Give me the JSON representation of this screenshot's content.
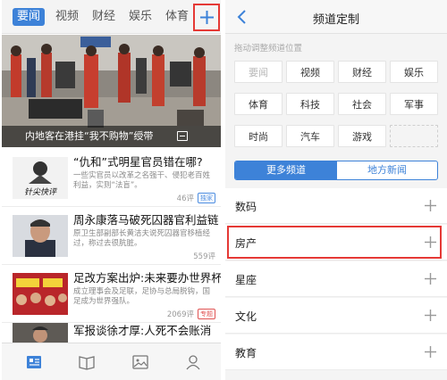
{
  "left": {
    "tabs": [
      {
        "label": "要闻",
        "active": true
      },
      {
        "label": "视频"
      },
      {
        "label": "财经"
      },
      {
        "label": "娱乐"
      },
      {
        "label": "体育"
      }
    ],
    "add_icon": "plus-icon",
    "hero": {
      "caption": "内地客在港挂“我不购物”绶带",
      "icon": "gallery-icon"
    },
    "news": [
      {
        "title": "“仇和”式明星官员错在哪?",
        "desc": "一些实官员以改革之名强干、侵犯老百姓利益，实则“法盲”。",
        "comments": "46评",
        "badge": "独家"
      },
      {
        "title": "周永康落马破死囚器官利益链",
        "desc": "原卫生部副部长黄洁夫说死囚器官移植经过，称过去很肮脏。",
        "comments": "559评",
        "badge": ""
      },
      {
        "title": "足改方案出炉:未来要办世界杯",
        "desc": "成立理事会及足联，足协与总局脱钩，国足成为世界强队。",
        "comments": "2069评",
        "badge": "专题"
      },
      {
        "title": "军报谈徐才厚:人死不会账消",
        "desc": "",
        "comments": "",
        "badge": ""
      }
    ],
    "bottom_nav": [
      "news-icon",
      "book-icon",
      "image-icon",
      "user-icon"
    ]
  },
  "right": {
    "title": "频道定制",
    "back_icon": "chevron-left-icon",
    "hint": "拖动调整频道位置",
    "channels": [
      "要闻",
      "视频",
      "财经",
      "娱乐",
      "体育",
      "科技",
      "社会",
      "军事",
      "时尚",
      "汽车",
      "游戏"
    ],
    "segment": {
      "more": "更多频道",
      "local": "地方新闻",
      "active": "more"
    },
    "more_channels": [
      "数码",
      "房产",
      "星座",
      "文化",
      "教育"
    ],
    "highlighted_channel": "房产"
  },
  "colors": {
    "accent": "#3d82d8",
    "highlight": "#e53935"
  }
}
